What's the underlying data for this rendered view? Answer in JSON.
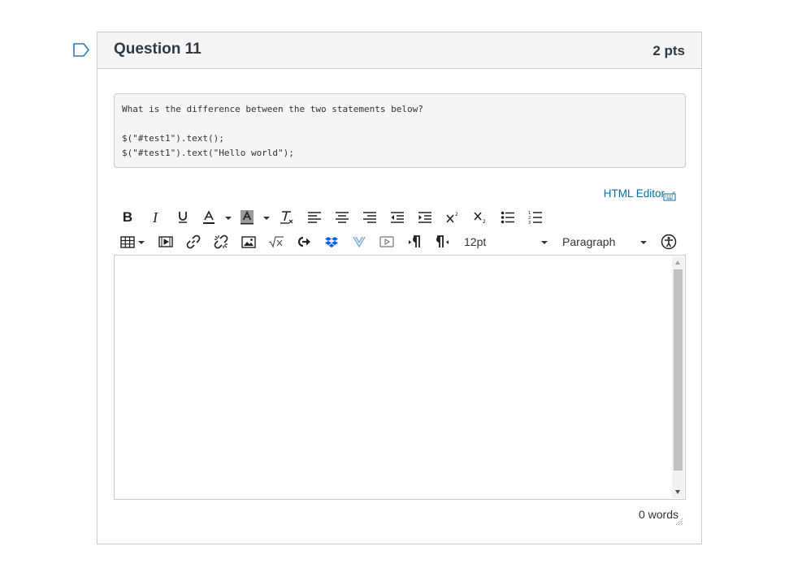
{
  "question": {
    "title": "Question 11",
    "points": "2 pts",
    "prompt_lines": [
      "What is the difference between the two statements below?",
      "",
      "$(\"#test1\").text();",
      "$(\"#test1\").text(\"Hello world\");"
    ]
  },
  "editor": {
    "html_editor_link": "HTML Editor",
    "font_size": "12pt",
    "block_format": "Paragraph",
    "word_count": "0 words",
    "content": ""
  },
  "toolbar": {
    "row1": [
      "bold-icon",
      "italic-icon",
      "underline-icon",
      "text-color-icon",
      "background-color-icon",
      "clear-formatting-icon",
      "align-left-icon",
      "align-center-icon",
      "align-right-icon",
      "outdent-icon",
      "indent-icon",
      "superscript-icon",
      "subscript-icon",
      "bullet-list-icon",
      "numbered-list-icon"
    ],
    "row2": [
      "table-icon",
      "media-icon",
      "link-icon",
      "unlink-icon",
      "image-icon",
      "equation-icon",
      "embed-icon",
      "dropbox-icon",
      "app-icon",
      "video-icon",
      "ltr-icon",
      "rtl-icon",
      "accessibility-icon"
    ]
  },
  "colors": {
    "link": "#0770a3",
    "header_bg": "#f5f5f5",
    "border": "#c7cdd1",
    "dropbox": "#0061fe"
  }
}
